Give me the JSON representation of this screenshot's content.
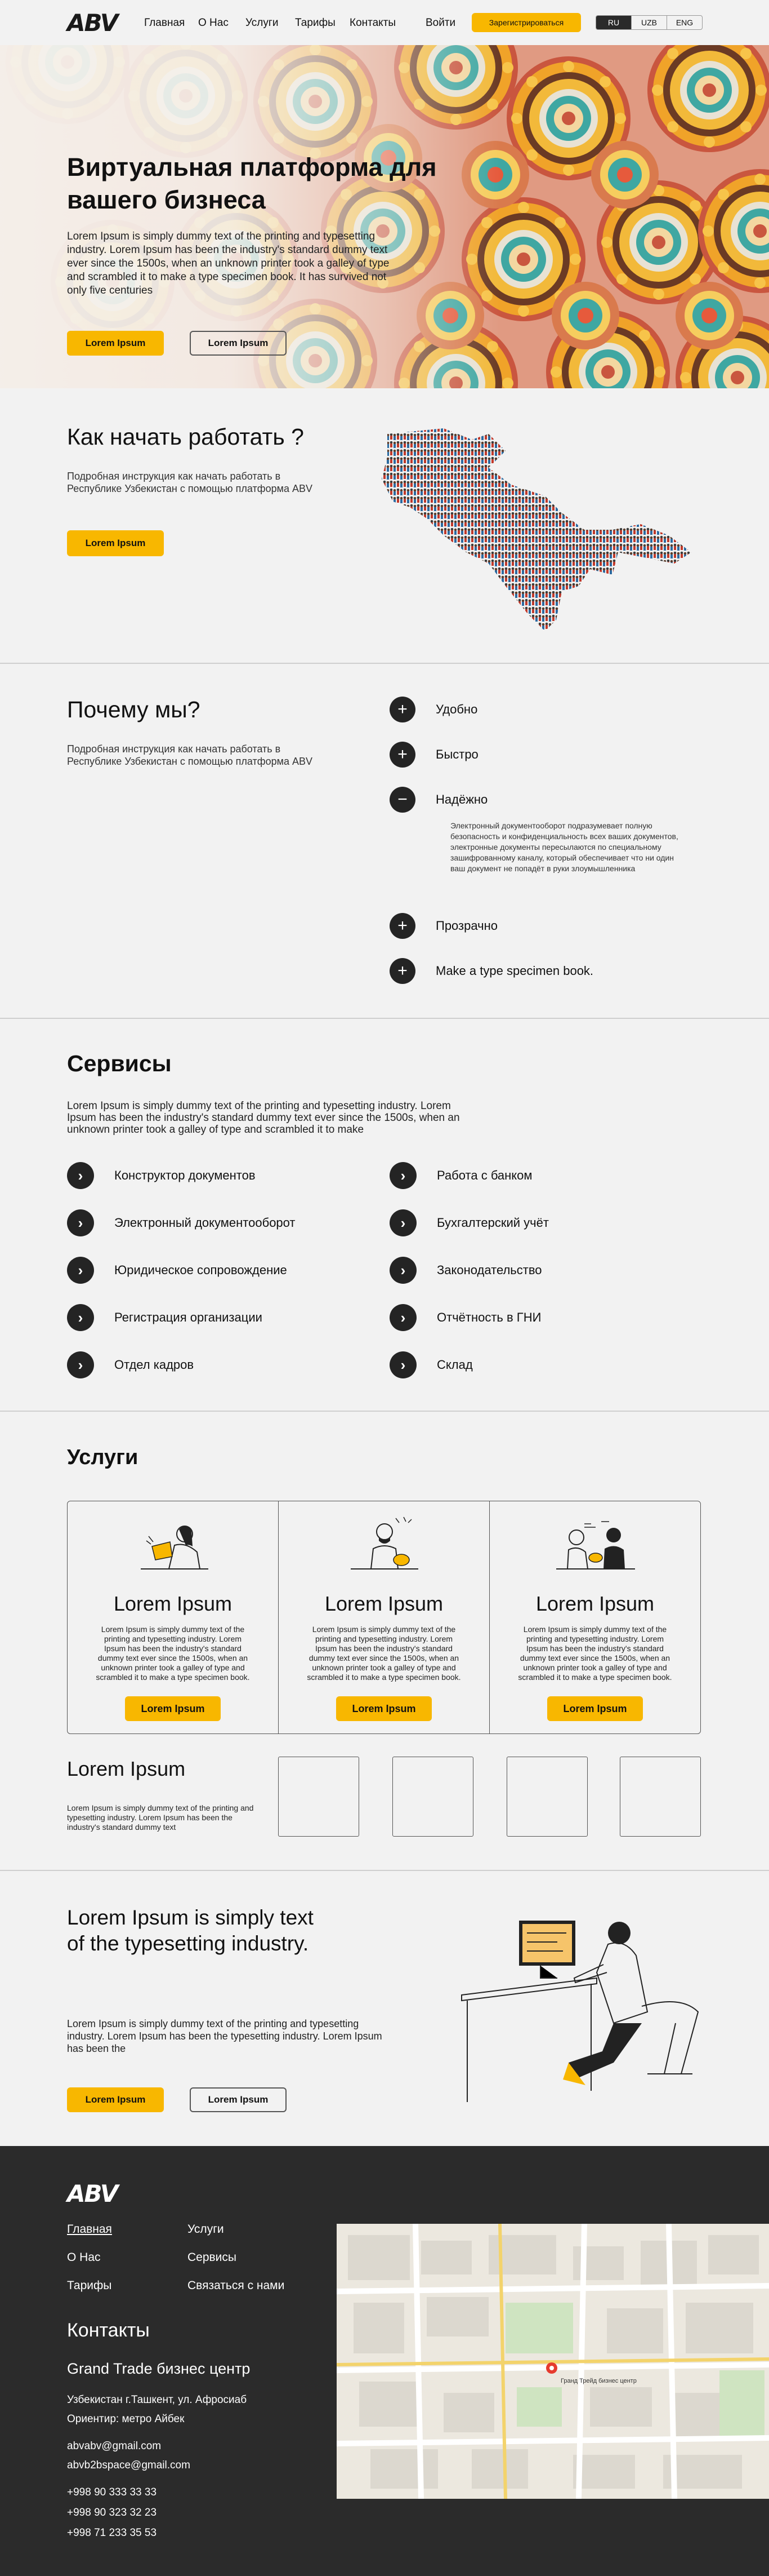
{
  "header": {
    "logo": "ABV",
    "nav": [
      "Главная",
      "О Нас",
      "Услуги",
      "Тарифы",
      "Контакты"
    ],
    "login": "Войти",
    "register": "Зарегистрироваться",
    "langs": [
      "RU",
      "UZB",
      "ENG"
    ],
    "active_lang": "RU"
  },
  "hero": {
    "title": "Виртуальная платформа для вашего бизнеса",
    "text": "Lorem Ipsum is simply dummy text of the printing and typesetting industry. Lorem Ipsum has been the industry's standard dummy text ever since the 1500s, when an unknown printer took a galley of type and scrambled it to make a type specimen book. It has survived not only five centuries",
    "btn_primary": "Lorem Ipsum",
    "btn_secondary": "Lorem Ipsum"
  },
  "start": {
    "title": "Как начать работать ?",
    "text": "Подробная инструкция как начать работать в Республике Узбекистан с помощью платформа ABV",
    "btn": "Lorem Ipsum"
  },
  "why": {
    "title": "Почему мы?",
    "text": "Подробная инструкция как начать работать в Республике Узбекистан с помощью платформа ABV",
    "items": [
      {
        "label": "Удобно",
        "icon": "+"
      },
      {
        "label": "Быстро",
        "icon": "+"
      },
      {
        "label": "Надёжно",
        "icon": "−"
      },
      {
        "label": "Прозрачно",
        "icon": "+"
      },
      {
        "label": "Make a type specimen book.",
        "icon": "+"
      }
    ],
    "expanded_text": "Электронный документооборот подразумевает полную безопасность и конфиденциальность всех ваших документов, электронные документы пересылаются по специальному зашифрованному каналу, который обеспечивает что ни один ваш документ не попадёт в руки злоумышленника"
  },
  "services": {
    "title": "Сервисы",
    "text": "Lorem Ipsum is simply dummy text of the printing and typesetting industry. Lorem Ipsum has been the industry's standard dummy text ever since the 1500s, when an unknown printer took a galley of type and scrambled it to make",
    "left": [
      "Конструктор документов",
      "Электронный документооборот",
      "Юридическое сопровождение",
      "Регистрация организации",
      "Отдел кадров"
    ],
    "right": [
      "Работа с банком",
      "Бухгалтерский учёт",
      "Законодательство",
      "Отчётность в ГНИ",
      "Склад"
    ]
  },
  "uslugi": {
    "title": "Услуги",
    "cards": [
      {
        "title": "Lorem Ipsum",
        "text": "Lorem Ipsum is simply dummy text of the printing and typesetting industry. Lorem Ipsum has been the industry's standard dummy text ever since the 1500s, when an unknown printer took a galley of type and scrambled it to make a type specimen book.",
        "btn": "Lorem Ipsum"
      },
      {
        "title": "Lorem Ipsum",
        "text": "Lorem Ipsum is simply dummy text of the printing and typesetting industry. Lorem Ipsum has been the industry's standard dummy text ever since the 1500s, when an unknown printer took a galley of type and scrambled it to make a type specimen book.",
        "btn": "Lorem Ipsum"
      },
      {
        "title": "Lorem Ipsum",
        "text": "Lorem Ipsum is simply dummy text of the printing and typesetting industry. Lorem Ipsum has been the industry's standard dummy text ever since the 1500s, when an unknown printer took a galley of type and scrambled it to make a type specimen book.",
        "btn": "Lorem Ipsum"
      }
    ],
    "sub_title": "Lorem Ipsum",
    "sub_text": "Lorem Ipsum is simply dummy text of the printing and typesetting industry. Lorem Ipsum has been the industry's standard dummy text"
  },
  "cta": {
    "title": "Lorem Ipsum is simply text of the  typesetting industry.",
    "text": "Lorem Ipsum is simply dummy text of the printing and typesetting industry. Lorem Ipsum has been the typesetting industry. Lorem Ipsum has been the",
    "btn_primary": "Lorem Ipsum",
    "btn_secondary": "Lorem Ipsum"
  },
  "footer": {
    "logo": "ABV",
    "links_left": [
      "Главная",
      "О Нас",
      "Тарифы"
    ],
    "links_right": [
      "Услуги",
      "Сервисы",
      "Связаться с нами"
    ],
    "contacts_title": "Контакты",
    "center": "Grand Trade бизнес центр",
    "address": "Узбекистан г.Ташкент, ул. Афросиаб",
    "landmark": "Ориентир: метро Айбек",
    "emails": [
      "abvabv@gmail.com",
      "abvb2bspace@gmail.com"
    ],
    "phones": [
      "+998 90 333 33 33",
      "+998 90 323 32 23",
      "+998 71 233 35 53"
    ],
    "map_label": "Гранд Трейд бизнес центр"
  },
  "colors": {
    "accent": "#f8b700",
    "dark": "#2b2b2b",
    "bg": "#f2f2f2"
  }
}
